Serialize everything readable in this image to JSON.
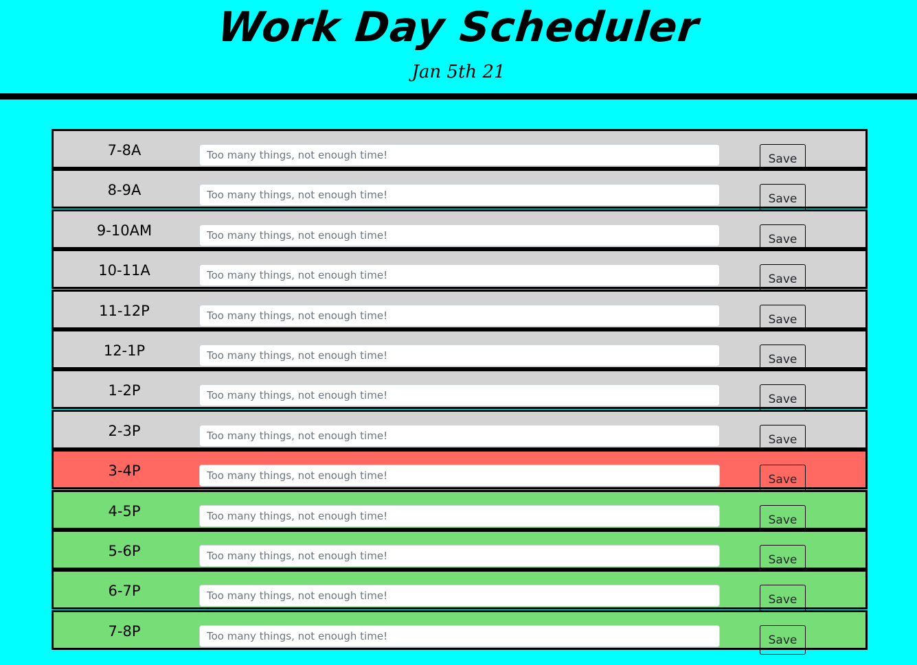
{
  "header": {
    "title": "Work Day Scheduler",
    "date": "Jan 5th 21"
  },
  "colors": {
    "page_background": "#00ffff",
    "past": "#d3d3d3",
    "present": "#ff6961",
    "future": "#77dd77"
  },
  "schedule": {
    "rows": [
      {
        "hour": "7-8A",
        "placeholder": "Too many things, not enough time!",
        "value": "",
        "save_label": "Save",
        "state": "past"
      },
      {
        "hour": "8-9A",
        "placeholder": "Too many things, not enough time!",
        "value": "",
        "save_label": "Save",
        "state": "past"
      },
      {
        "hour": "9-10AM",
        "placeholder": "Too many things, not enough time!",
        "value": "",
        "save_label": "Save",
        "state": "past"
      },
      {
        "hour": "10-11A",
        "placeholder": "Too many things, not enough time!",
        "value": "",
        "save_label": "Save",
        "state": "past"
      },
      {
        "hour": "11-12P",
        "placeholder": "Too many things, not enough time!",
        "value": "",
        "save_label": "Save",
        "state": "past"
      },
      {
        "hour": "12-1P",
        "placeholder": "Too many things, not enough time!",
        "value": "",
        "save_label": "Save",
        "state": "past"
      },
      {
        "hour": "1-2P",
        "placeholder": "Too many things, not enough time!",
        "value": "",
        "save_label": "Save",
        "state": "past"
      },
      {
        "hour": "2-3P",
        "placeholder": "Too many things, not enough time!",
        "value": "",
        "save_label": "Save",
        "state": "past"
      },
      {
        "hour": "3-4P",
        "placeholder": "Too many things, not enough time!",
        "value": "",
        "save_label": "Save",
        "state": "present"
      },
      {
        "hour": "4-5P",
        "placeholder": "Too many things, not enough time!",
        "value": "",
        "save_label": "Save",
        "state": "future"
      },
      {
        "hour": "5-6P",
        "placeholder": "Too many things, not enough time!",
        "value": "",
        "save_label": "Save",
        "state": "future"
      },
      {
        "hour": "6-7P",
        "placeholder": "Too many things, not enough time!",
        "value": "",
        "save_label": "Save",
        "state": "future"
      },
      {
        "hour": "7-8P",
        "placeholder": "Too many things, not enough time!",
        "value": "",
        "save_label": "Save",
        "state": "future"
      }
    ]
  }
}
